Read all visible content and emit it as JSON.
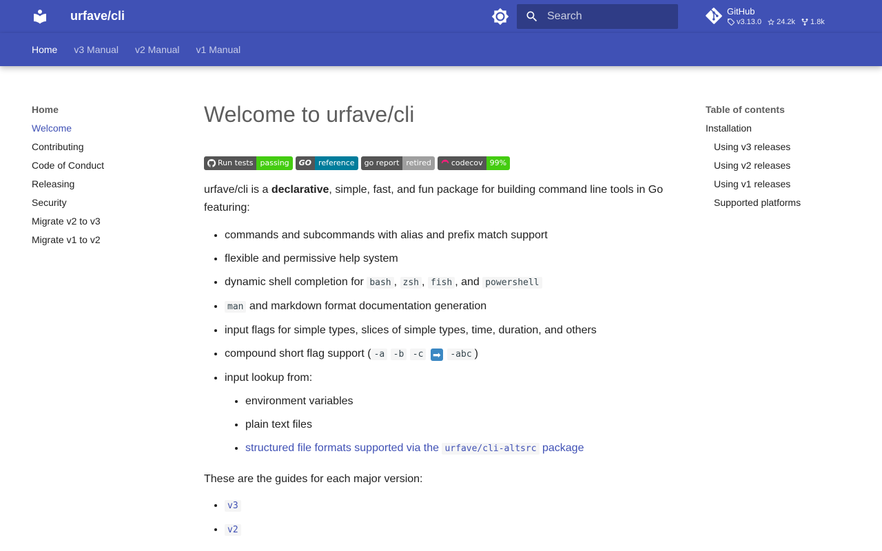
{
  "header": {
    "site_title": "urfave/cli",
    "search_placeholder": "Search",
    "repo": {
      "name": "GitHub",
      "version": "v3.13.0",
      "stars": "24.2k",
      "forks": "1.8k"
    }
  },
  "tabs": [
    {
      "label": "Home"
    },
    {
      "label": "v3 Manual"
    },
    {
      "label": "v2 Manual"
    },
    {
      "label": "v1 Manual"
    }
  ],
  "nav": {
    "title": "Home",
    "items": [
      {
        "label": "Welcome"
      },
      {
        "label": "Contributing"
      },
      {
        "label": "Code of Conduct"
      },
      {
        "label": "Releasing"
      },
      {
        "label": "Security"
      },
      {
        "label": "Migrate v2 to v3"
      },
      {
        "label": "Migrate v1 to v2"
      }
    ]
  },
  "toc": {
    "title": "Table of contents",
    "items": [
      {
        "label": "Installation"
      },
      {
        "label": "Using v3 releases"
      },
      {
        "label": "Using v2 releases"
      },
      {
        "label": "Using v1 releases"
      },
      {
        "label": "Supported platforms"
      }
    ]
  },
  "main": {
    "title": "Welcome to urfave/cli",
    "badges": {
      "run_tests_label": "Run tests",
      "run_tests_status": "passing",
      "go_label": "GO",
      "reference": "reference",
      "goreport_label": "go report",
      "goreport_status": "retired",
      "codecov_label": "codecov",
      "codecov_value": "99%"
    },
    "intro_pre": "urfave/cli is a ",
    "intro_bold": "declarative",
    "intro_post": ", simple, fast, and fun package for building command line tools in Go featuring:",
    "features": {
      "f1": "commands and subcommands with alias and prefix match support",
      "f2": "flexible and permissive help system",
      "f3_pre": "dynamic shell completion for ",
      "f3_c1": "bash",
      "f3_sep1": ", ",
      "f3_c2": "zsh",
      "f3_sep2": ", ",
      "f3_c3": "fish",
      "f3_sep3": ", and ",
      "f3_c4": "powershell",
      "f4_code": "man",
      "f4_text": " and markdown format documentation generation",
      "f5": "input flags for simple types, slices of simple types, time, duration, and others",
      "f6_pre": "compound short flag support (",
      "f6_c1": "-a",
      "f6_c2": "-b",
      "f6_c3": "-c",
      "f6_arrow": "➡",
      "f6_c4": "-abc",
      "f6_post": ")",
      "f7": "input lookup from:",
      "sub1": "environment variables",
      "sub2": "plain text files",
      "sub3_pre": "structured file formats supported via the ",
      "sub3_code": "urfave/cli-altsrc",
      "sub3_post": " package"
    },
    "guides_text": "These are the guides for each major version:",
    "versions": [
      "v3",
      "v2"
    ]
  },
  "colors": {
    "primary": "#4051b5",
    "text": "#212121",
    "muted": "#5e5e5e"
  }
}
